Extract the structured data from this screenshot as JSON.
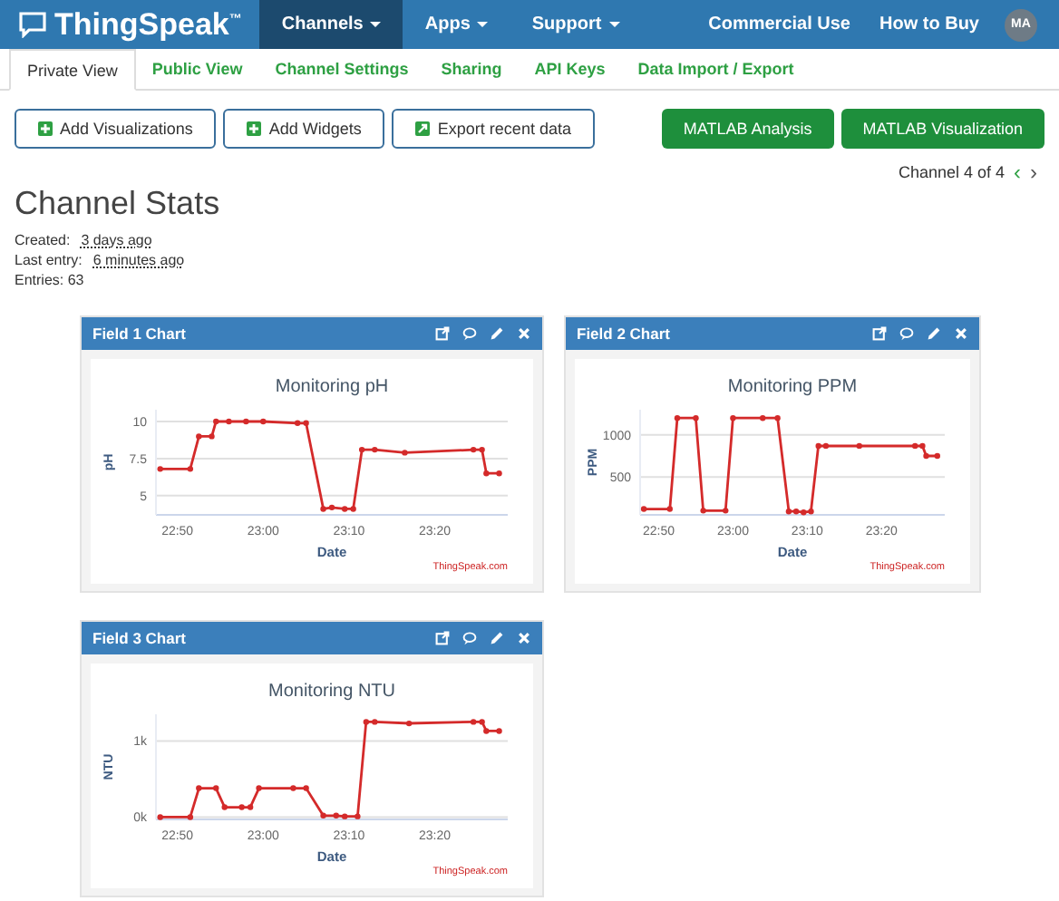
{
  "navbar": {
    "brand": "ThingSpeak$^{™}$",
    "menus": [
      {
        "label": "Channels",
        "selected": true,
        "has_menu": true
      },
      {
        "label": "Apps",
        "selected": false,
        "has_menu": true
      },
      {
        "label": "Support",
        "selected": false,
        "has_menu": true
      }
    ],
    "links": [
      "Commercial Use",
      "How to Buy"
    ],
    "avatar": "MA"
  },
  "tabs": [
    {
      "label": "Private View",
      "selected": true
    },
    {
      "label": "Public View",
      "selected": false
    },
    {
      "label": "Channel Settings",
      "selected": false
    },
    {
      "label": "Sharing",
      "selected": false
    },
    {
      "label": "API Keys",
      "selected": false
    },
    {
      "label": "Data Import / Export",
      "selected": false
    }
  ],
  "actions": [
    {
      "label": "Add Visualizations",
      "kind": "add"
    },
    {
      "label": "Add Widgets",
      "kind": "add"
    },
    {
      "label": "Export recent data",
      "kind": "export"
    }
  ],
  "matlab_buttons": [
    "MATLAB Analysis",
    "MATLAB Visualization"
  ],
  "pager": {
    "label": "Channel 4 of 4",
    "prev": "‹",
    "next": "›"
  },
  "stats": {
    "title": "Channel Stats",
    "created_label": "Created:",
    "created": "3 days ago",
    "last_entry_label": "Last entry:",
    "last_entry": "6 minutes ago",
    "entries": "Entries: 63"
  },
  "cards": [
    {
      "title": "Field 1 Chart",
      "credit": "ThingSpeak.com",
      "chart_data": {
        "type": "line",
        "title": "Monitoring pH",
        "xlabel": "Date",
        "ylabel": "pH",
        "x": [
          1368,
          1371.5,
          1372.5,
          1374,
          1374.5,
          1376,
          1378,
          1380,
          1384,
          1385,
          1387,
          1388,
          1389.5,
          1390.5,
          1391.5,
          1393,
          1396.5,
          1404.5,
          1405.5,
          1406,
          1407.5
        ],
        "series": [
          {
            "color": "#d42a2a",
            "marker": "circle",
            "values": [
              6.8,
              6.8,
              9,
              9,
              10,
              10,
              10,
              10,
              9.9,
              9.9,
              4.1,
              4.2,
              4.1,
              4.1,
              8.1,
              8.1,
              7.9,
              8.1,
              8.1,
              6.5,
              6.5
            ]
          }
        ],
        "xlim": [
          1367.5,
          1408.5
        ],
        "ylim": [
          3.7,
          10.8
        ],
        "grid": true,
        "xticks": [
          {
            "value": 1370,
            "label": "22:50"
          },
          {
            "value": 1380,
            "label": "23:00"
          },
          {
            "value": 1390,
            "label": "23:10"
          },
          {
            "value": 1400,
            "label": "23:20"
          }
        ],
        "yticks": [
          5,
          7.5,
          10
        ]
      }
    },
    {
      "title": "Field 2 Chart",
      "credit": "ThingSpeak.com",
      "chart_data": {
        "type": "line",
        "title": "Monitoring PPM",
        "xlabel": "Date",
        "ylabel": "PPM",
        "x": [
          1368,
          1371.5,
          1372.5,
          1375,
          1376,
          1379,
          1380,
          1384,
          1386,
          1387.5,
          1388.5,
          1389.5,
          1390.5,
          1391.5,
          1392.5,
          1397,
          1404.5,
          1405.5,
          1406,
          1407.5
        ],
        "series": [
          {
            "color": "#d42a2a",
            "marker": "circle",
            "values": [
              120,
              120,
              1200,
              1200,
              100,
              100,
              1200,
              1200,
              1200,
              90,
              90,
              80,
              90,
              870,
              870,
              870,
              870,
              870,
              750,
              750
            ]
          }
        ],
        "xlim": [
          1367.5,
          1408.5
        ],
        "ylim": [
          50,
          1300
        ],
        "grid": true,
        "xticks": [
          {
            "value": 1370,
            "label": "22:50"
          },
          {
            "value": 1380,
            "label": "23:00"
          },
          {
            "value": 1390,
            "label": "23:10"
          },
          {
            "value": 1400,
            "label": "23:20"
          }
        ],
        "yticks": [
          500,
          1000
        ]
      }
    },
    {
      "title": "Field 3 Chart",
      "credit": "ThingSpeak.com",
      "chart_data": {
        "type": "line",
        "title": "Monitoring NTU",
        "xlabel": "Date",
        "ylabel": "NTU",
        "x": [
          1368,
          1371.5,
          1372.5,
          1374.5,
          1375.5,
          1377.5,
          1378.5,
          1379.5,
          1383.5,
          1385,
          1387,
          1388.5,
          1389.5,
          1391,
          1392,
          1393,
          1397,
          1404.5,
          1405.5,
          1406,
          1407.5
        ],
        "series": [
          {
            "color": "#d42a2a",
            "marker": "circle",
            "values": [
              0,
              0,
              380,
              380,
              130,
              130,
              130,
              380,
              380,
              380,
              20,
              20,
              10,
              10,
              1250,
              1250,
              1230,
              1250,
              1250,
              1130,
              1130
            ]
          }
        ],
        "xlim": [
          1367.5,
          1408.5
        ],
        "ylim": [
          -30,
          1350
        ],
        "grid": true,
        "xticks": [
          {
            "value": 1370,
            "label": "22:50"
          },
          {
            "value": 1380,
            "label": "23:00"
          },
          {
            "value": 1390,
            "label": "23:10"
          },
          {
            "value": 1400,
            "label": "23:20"
          }
        ],
        "yticks": [
          {
            "value": 0,
            "label": "0k"
          },
          {
            "value": 1000,
            "label": "1k"
          }
        ]
      }
    }
  ]
}
